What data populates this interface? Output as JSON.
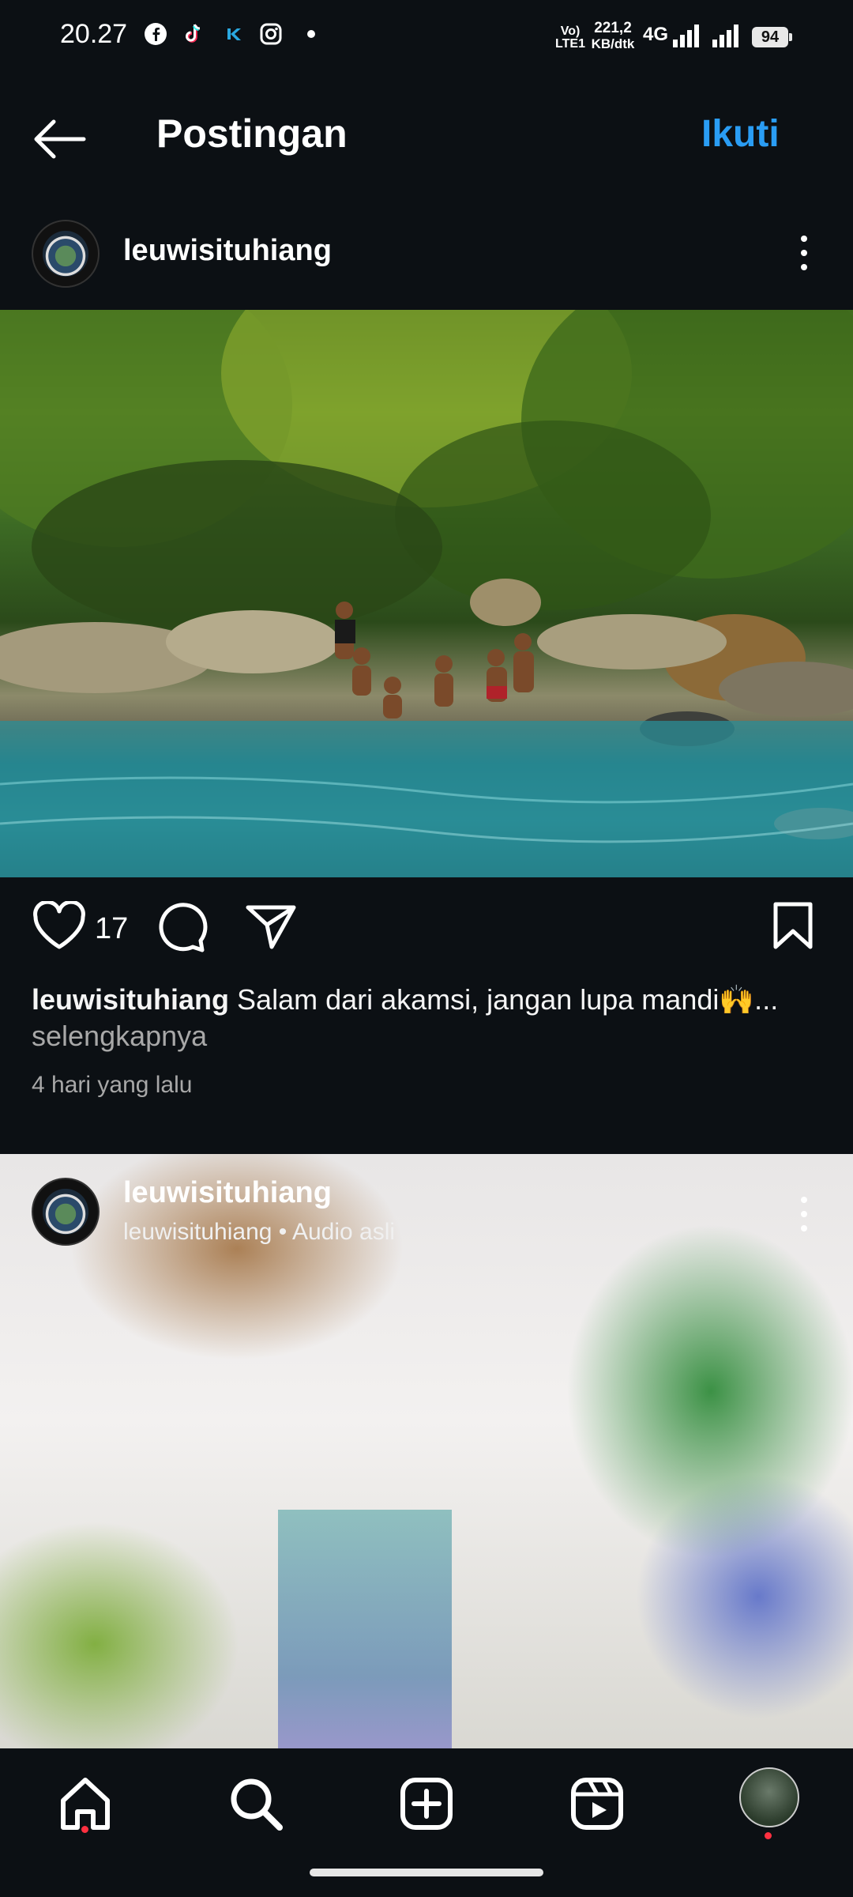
{
  "status_bar": {
    "time": "20.27",
    "network_top": "Vo) LTE1",
    "speed": "221,2",
    "speed_unit": "KB/dtk",
    "network_type": "4G",
    "battery": "94",
    "notification_icons": [
      "facebook-icon",
      "tiktok-icon",
      "app-k-icon",
      "instagram-icon",
      "dot-icon"
    ]
  },
  "header": {
    "title": "Postingan",
    "follow_label": "Ikuti"
  },
  "post1": {
    "username": "leuwisituhiang",
    "like_count": "17",
    "caption_user": "leuwisituhiang",
    "caption_text": "Salam dari akamsi, jangan lupa mandi🙌...",
    "see_more": "selengkapnya",
    "time_ago": "4 hari yang lalu"
  },
  "post2": {
    "username": "leuwisituhiang",
    "audio": "leuwisituhiang • Audio asli"
  },
  "bottom_nav": {
    "items": [
      "home-icon",
      "search-icon",
      "create-icon",
      "reels-icon",
      "profile-avatar"
    ]
  },
  "colors": {
    "background": "#0c1014",
    "accent": "#2a9df4",
    "notification": "#ff3040"
  }
}
